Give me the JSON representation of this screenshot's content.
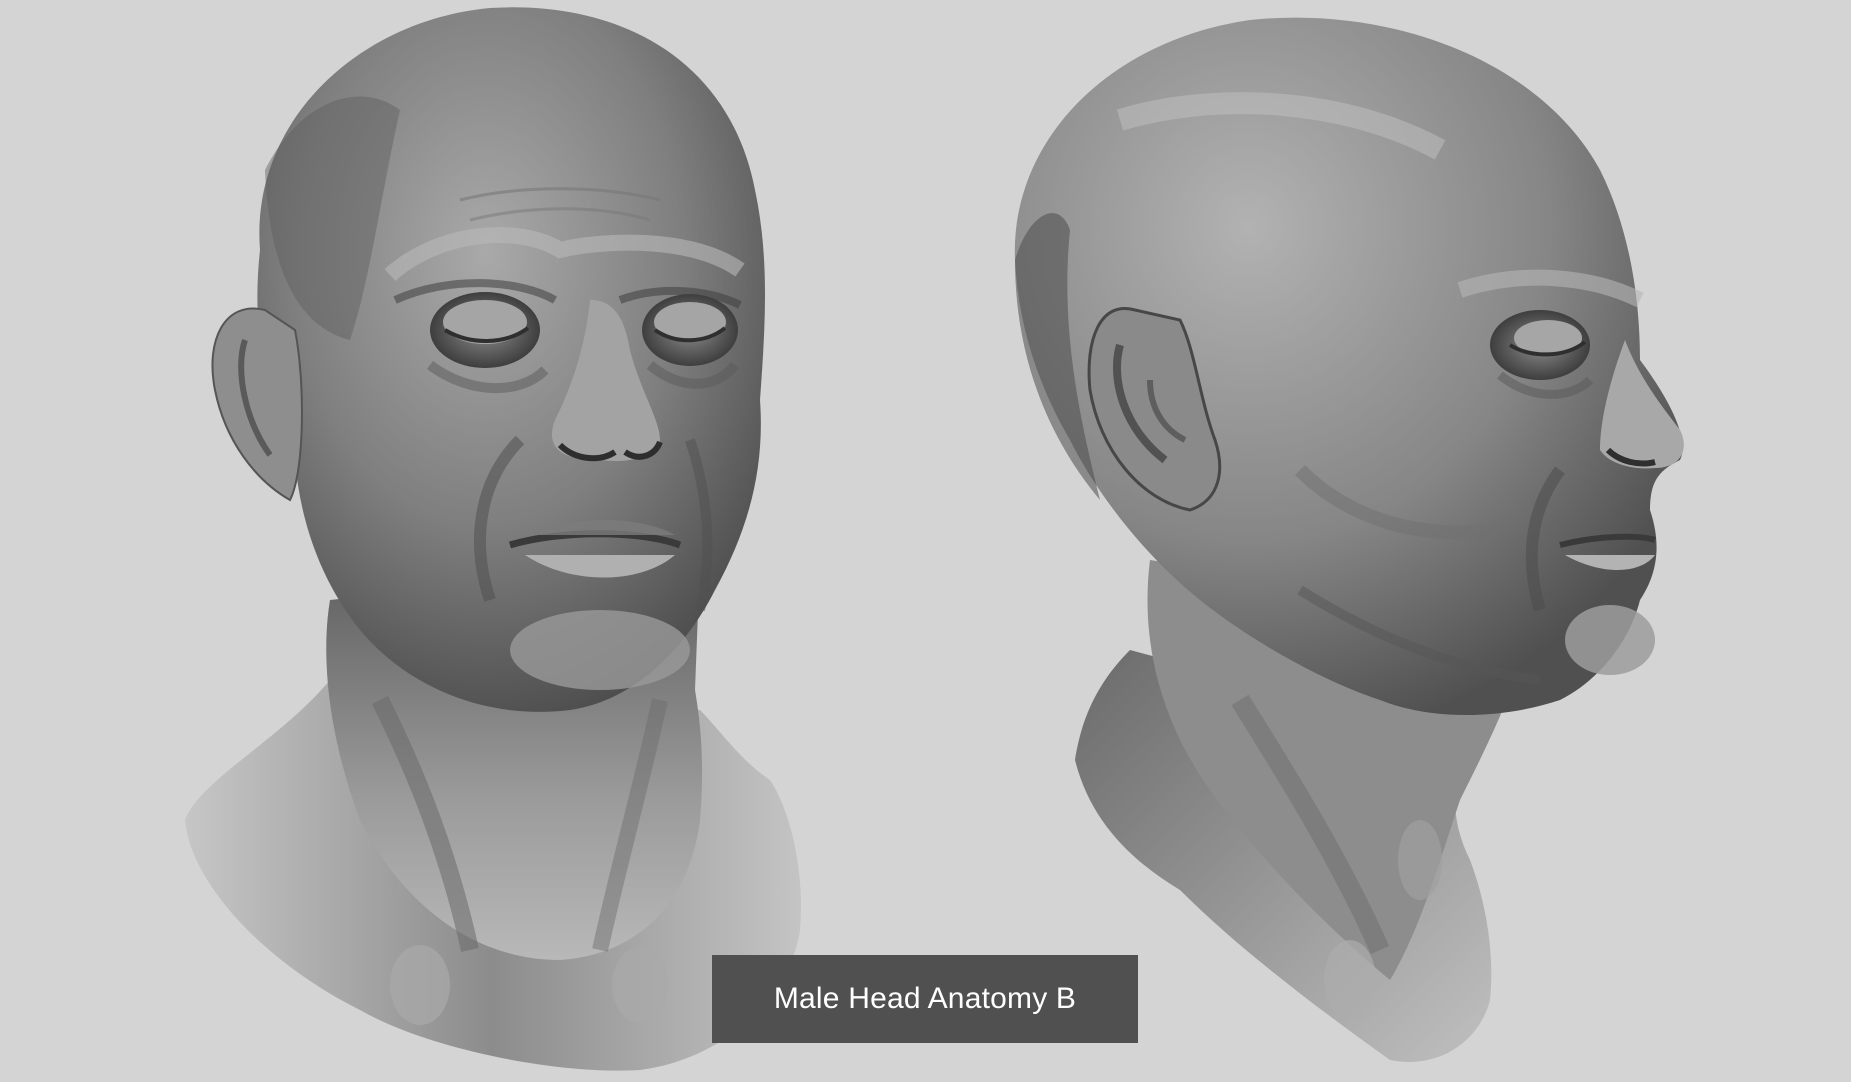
{
  "caption": {
    "text": "Male Head Anatomy B"
  },
  "colors": {
    "background": "#d4d4d4",
    "caption_background": "#505050",
    "caption_text": "#ffffff",
    "sculpt_base": "#8a8a8a"
  },
  "views": [
    {
      "name": "front three-quarter view",
      "icon": "head-front-render"
    },
    {
      "name": "right profile three-quarter view",
      "icon": "head-profile-render"
    }
  ]
}
